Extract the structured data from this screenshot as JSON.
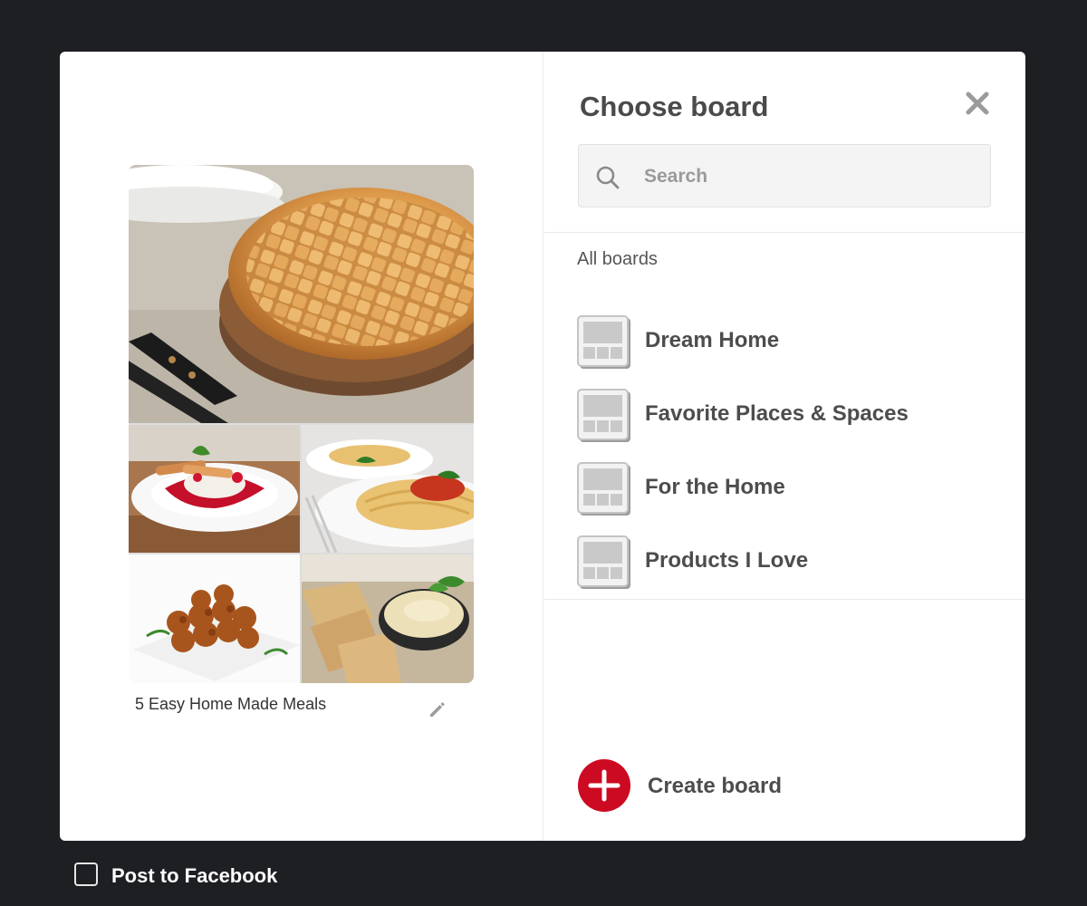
{
  "modal": {
    "pin": {
      "description": "5 Easy Home Made Meals",
      "images": [
        "lattice-apple-pie",
        "berry-dessert",
        "spaghetti",
        "chicken-skewers",
        "hummus-with-pita"
      ]
    },
    "board_picker": {
      "title": "Choose board",
      "search": {
        "placeholder": "Search",
        "value": ""
      },
      "section_label": "All boards",
      "boards": [
        {
          "name": "Dream Home"
        },
        {
          "name": "Favorite Places & Spaces"
        },
        {
          "name": "For the Home"
        },
        {
          "name": "Products I Love"
        }
      ],
      "create_label": "Create board"
    }
  },
  "footer": {
    "post_to_facebook_label": "Post to Facebook",
    "post_to_facebook_checked": false
  },
  "colors": {
    "accent": "#cc0a21",
    "backdrop": "#1d1f23",
    "text": "#4d4d4d"
  },
  "icons": [
    "search-icon",
    "close-icon",
    "pencil-icon",
    "board-icon",
    "plus-icon"
  ]
}
